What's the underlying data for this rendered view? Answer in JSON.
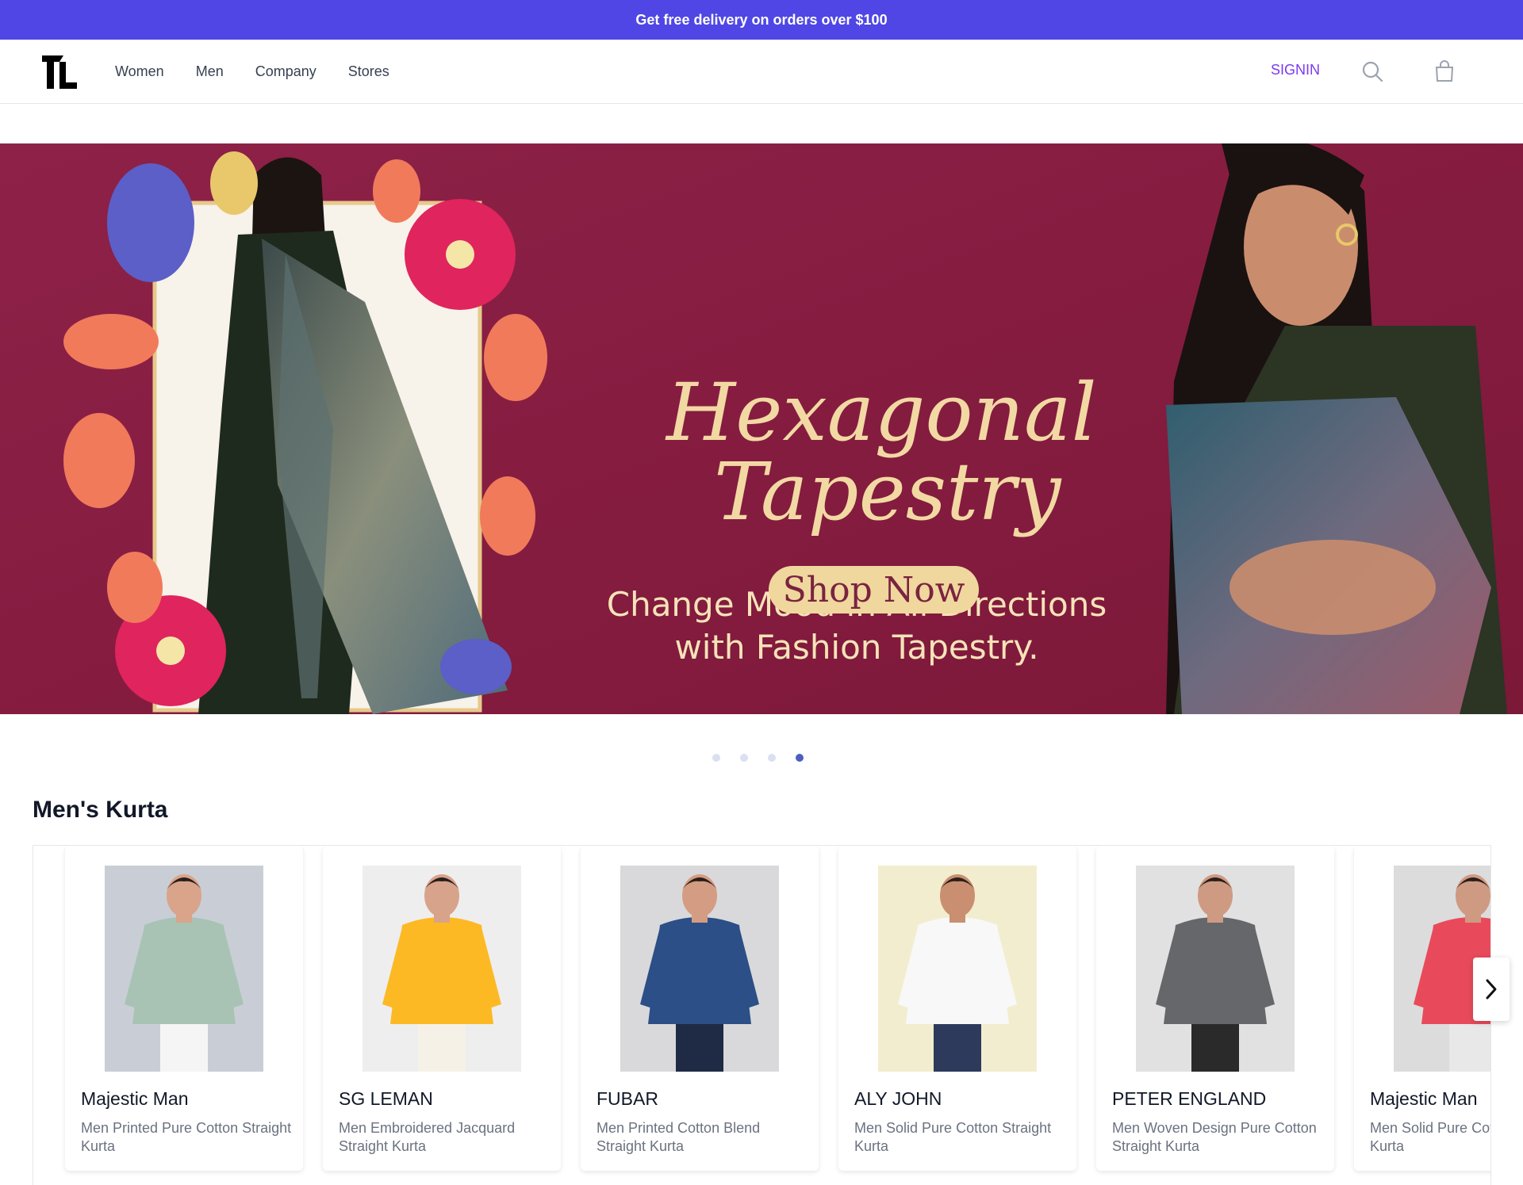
{
  "promo": {
    "text": "Get free delivery on orders over $100"
  },
  "header": {
    "logo_text": "TL",
    "nav": [
      "Women",
      "Men",
      "Company",
      "Stores"
    ],
    "signin_label": "SIGNIN",
    "icons": {
      "search": "search-icon",
      "cart": "shopping-bag-icon"
    }
  },
  "hero": {
    "title_line1": "Hexagonal",
    "title_line2": "Tapestry",
    "subtitle": "Change Mood in All Directions with Fashion Tapestry.",
    "button_label": "Shop Now",
    "colors": {
      "background": "#8a1d42",
      "accent": "#f2d9a3"
    }
  },
  "carousel_dots": {
    "count": 4,
    "active_index": 3
  },
  "section": {
    "title": "Men's Kurta",
    "products": [
      {
        "brand": "Majestic Man",
        "desc": "Men Printed Pure Cotton Straight Kurta",
        "bg": "#c9ced6",
        "shirt": "#a8c3b4",
        "pants": "#f5f5f5",
        "skin": "#d9a48a"
      },
      {
        "brand": "SG LEMAN",
        "desc": "Men Embroidered Jacquard Straight Kurta",
        "bg": "#eeeeee",
        "shirt": "#fdb924",
        "pants": "#f6f1e6",
        "skin": "#d8a38b"
      },
      {
        "brand": "FUBAR",
        "desc": "Men Printed Cotton Blend Straight Kurta",
        "bg": "#d9d9db",
        "shirt": "#2b4f86",
        "pants": "#1f2a44",
        "skin": "#d49c82"
      },
      {
        "brand": "ALY JOHN",
        "desc": "Men Solid Pure Cotton Straight Kurta",
        "bg": "#f3edcf",
        "shirt": "#f8f8f8",
        "pants": "#2d3a5c",
        "skin": "#c98f70"
      },
      {
        "brand": "PETER ENGLAND",
        "desc": "Men Woven Design Pure Cotton Straight Kurta",
        "bg": "#e1e1e1",
        "shirt": "#65676a",
        "pants": "#2a2a2a",
        "skin": "#cf9a82"
      },
      {
        "brand": "Majestic Man",
        "desc": "Men Solid Pure Cotton Straight Kurta",
        "bg": "#dcdcdc",
        "shirt": "#e94a5b",
        "pants": "#e8e8e8",
        "skin": "#cf9a82"
      }
    ],
    "next_icon": "chevron-right-icon"
  }
}
